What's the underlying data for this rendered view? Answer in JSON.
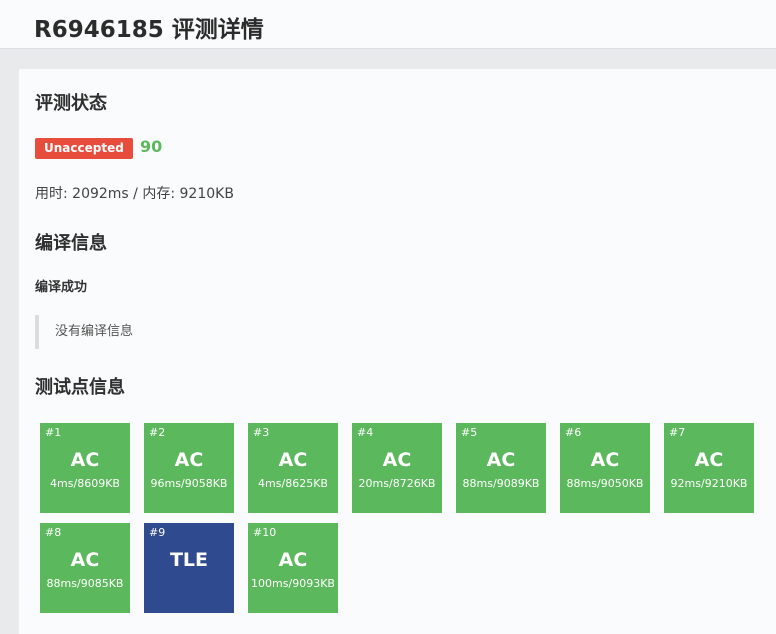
{
  "header": {
    "title": "R6946185 评测详情"
  },
  "status_section": {
    "heading": "评测状态",
    "badge": "Unaccepted",
    "badge_color": "#e74c3c",
    "score": "90",
    "usage": "用时: 2092ms / 内存: 9210KB"
  },
  "compile_section": {
    "heading": "编译信息",
    "status": "编译成功",
    "message": "没有编译信息"
  },
  "tests_section": {
    "heading": "测试点信息",
    "cases": [
      {
        "num": "#1",
        "status": "AC",
        "usage": "4ms/8609KB"
      },
      {
        "num": "#2",
        "status": "AC",
        "usage": "96ms/9058KB"
      },
      {
        "num": "#3",
        "status": "AC",
        "usage": "4ms/8625KB"
      },
      {
        "num": "#4",
        "status": "AC",
        "usage": "20ms/8726KB"
      },
      {
        "num": "#5",
        "status": "AC",
        "usage": "88ms/9089KB"
      },
      {
        "num": "#6",
        "status": "AC",
        "usage": "88ms/9050KB"
      },
      {
        "num": "#7",
        "status": "AC",
        "usage": "92ms/9210KB"
      },
      {
        "num": "#8",
        "status": "AC",
        "usage": "88ms/9085KB"
      },
      {
        "num": "#9",
        "status": "TLE",
        "usage": ""
      },
      {
        "num": "#10",
        "status": "AC",
        "usage": "100ms/9093KB"
      }
    ],
    "colors": {
      "AC": "#5cb85c",
      "TLE": "#2f4a8e"
    }
  }
}
